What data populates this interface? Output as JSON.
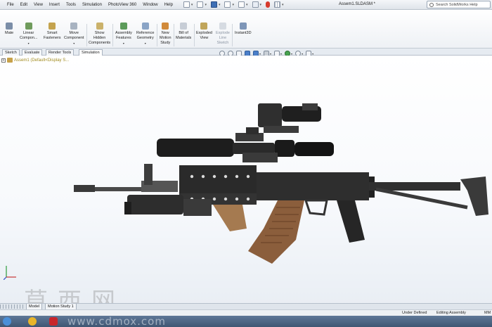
{
  "menubar": {
    "items": [
      "File",
      "Edit",
      "View",
      "Insert",
      "Tools",
      "Simulation",
      "PhotoView 360",
      "Window",
      "Help"
    ],
    "document_title": "Assem1.SLDASM *",
    "search_placeholder": "Search SolidWorks Help"
  },
  "command_manager": {
    "buttons": [
      {
        "label": "Mate",
        "icon": "mate-icon"
      },
      {
        "label": "Linear\nCompon...",
        "icon": "linear-pattern-icon",
        "has_arrow": true
      },
      {
        "label": "Smart\nFasteners",
        "icon": "smart-fasteners-icon"
      },
      {
        "label": "Move\nComponent",
        "icon": "move-component-icon",
        "has_arrow": true
      },
      {
        "label": "Show\nHidden\nComponents",
        "icon": "show-hidden-icon"
      },
      {
        "label": "Assembly\nFeatures",
        "icon": "assembly-features-icon",
        "has_arrow": true
      },
      {
        "label": "Reference\nGeometry",
        "icon": "reference-geometry-icon",
        "has_arrow": true
      },
      {
        "label": "New\nMotion\nStudy",
        "icon": "motion-study-icon"
      },
      {
        "label": "Bill of\nMaterials",
        "icon": "bom-icon"
      },
      {
        "label": "Exploded\nView",
        "icon": "exploded-view-icon"
      },
      {
        "label": "Explode\nLine\nSketch",
        "icon": "explode-line-icon"
      },
      {
        "label": "Instant3D",
        "icon": "instant3d-icon"
      }
    ]
  },
  "tabs": [
    "Sketch",
    "Evaluate",
    "Render Tools",
    "Simulation"
  ],
  "feature_tree": {
    "root_label": "Assem1 (Default<Display S..."
  },
  "bottom_tabs": [
    "Model",
    "Motion Study 1"
  ],
  "status": {
    "state": "Under Defined",
    "mode": "Editing Assembly",
    "units": "MM"
  },
  "watermark": {
    "chinese": "草西网",
    "url": "www.cdmox.com"
  },
  "colors": {
    "menubar": "#dfe4ea",
    "tree_text": "#a08a1e",
    "model_dark": "#2c2c2c",
    "magazine": "#8b5e3c",
    "grip": "#a57a50"
  }
}
